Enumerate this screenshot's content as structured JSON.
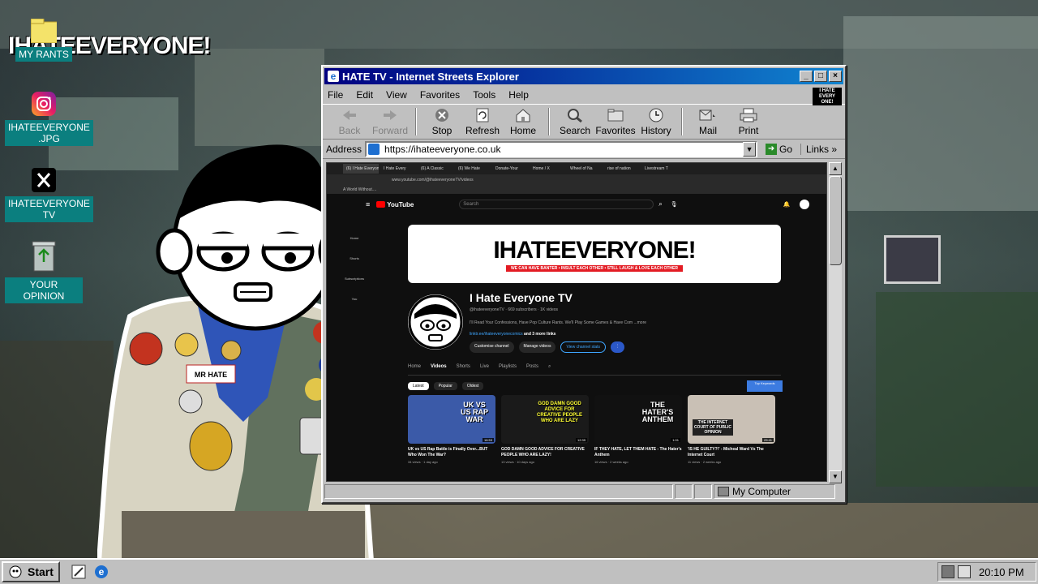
{
  "desktop": {
    "logo_text": "IHATEEVERYONE!",
    "icons": [
      {
        "label": "MY RANTS",
        "icon": "folder-icon"
      },
      {
        "label": "IHATEEVERYONE\n.JPG",
        "icon": "instagram-icon"
      },
      {
        "label": "IHATEEVERYONE\nTV",
        "icon": "x-icon"
      },
      {
        "label": "YOUR OPINION",
        "icon": "recycle-bin-icon"
      }
    ]
  },
  "window": {
    "title": "HATE TV - Internet Streets Explorer",
    "menu": [
      "File",
      "Edit",
      "View",
      "Favorites",
      "Tools",
      "Help"
    ],
    "toolbar": [
      "Back",
      "Forward",
      "Stop",
      "Refresh",
      "Home",
      "Search",
      "Favorites",
      "History",
      "Mail",
      "Print"
    ],
    "address_label": "Address",
    "address_value": "https://ihateeveryone.co.uk",
    "go_label": "Go",
    "links_label": "Links",
    "status_zone": "My Computer"
  },
  "inner_browser": {
    "tabs": [
      "(6) I Hate Everyone TV",
      "I Hate Every",
      "(6) A Classic",
      "(6) We Hate",
      "Donate-Your",
      "Home / X",
      "Wheel of Na",
      "rise of nation",
      "Livestream T"
    ],
    "url": "www.youtube.com/@ihateeveryoneTV/videos",
    "bookmark": "A World Without....",
    "search_placeholder": "Search"
  },
  "youtube": {
    "logo": "YouTube",
    "sidebar": [
      "Home",
      "Shorts",
      "Subscriptions",
      "You"
    ],
    "banner_title": "IHATEEVERYONE!",
    "banner_strip": "WE CAN HAVE BANTER • INSULT EACH OTHER • STILL LAUGH & LOVE EACH OTHER",
    "channel_name": "I Hate Everyone TV",
    "handle_meta": "@ihateeveryoneTV · 669 subscribers · 1K videos",
    "description": "I'll Read Your Confessions, Have Pop Culture Rants. We'll Play Some Games & Have Com ...more",
    "links_text": "linktr.ee/ihateeveryonecomics",
    "links_more": "and 3 more links",
    "buttons": [
      "Customise channel",
      "Manage videos",
      "View channel stats"
    ],
    "nav": [
      "Home",
      "Videos",
      "Shorts",
      "Live",
      "Playlists",
      "Posts"
    ],
    "chips": [
      "Latest",
      "Popular",
      "Oldest"
    ],
    "keywords_btn": "Top Keywords",
    "videos": [
      {
        "title": "UK vs US Rap Battle is Finally Over...BUT Who Won The War?",
        "meta": "34 views · 1 day ago",
        "thumb_text": "UK VS US RAP WAR",
        "duration": "16:53",
        "bg": "#3b5aa8"
      },
      {
        "title": "GOD DAMN GOOD ADVICE FOR CREATIVE PEOPLE WHO ARE LAZY!",
        "meta": "13 views · 10 days ago",
        "thumb_text": "GOD DAMN GOOD ADVICE FOR CREATIVE PEOPLE WHO ARE LAZY",
        "duration": "12:39",
        "bg": "#1a1a1a"
      },
      {
        "title": "IF THEY HATE, LET THEM HATE - The Hater's Anthem",
        "meta": "16 views · 2 weeks ago",
        "thumb_text": "THE HATER'S ANTHEM",
        "duration": "1:01",
        "bg": "#111111"
      },
      {
        "title": "'IS HE GUILTY?!' - Micheal Ward Vs The Internet Court",
        "meta": "11 views · 2 weeks ago",
        "thumb_text": "THE INTERNET COURT OF PUBLIC OPINION",
        "duration": "29:41",
        "bg": "#c9c0b5"
      }
    ]
  },
  "taskbar": {
    "start_label": "Start",
    "clock": "20:10 PM"
  }
}
